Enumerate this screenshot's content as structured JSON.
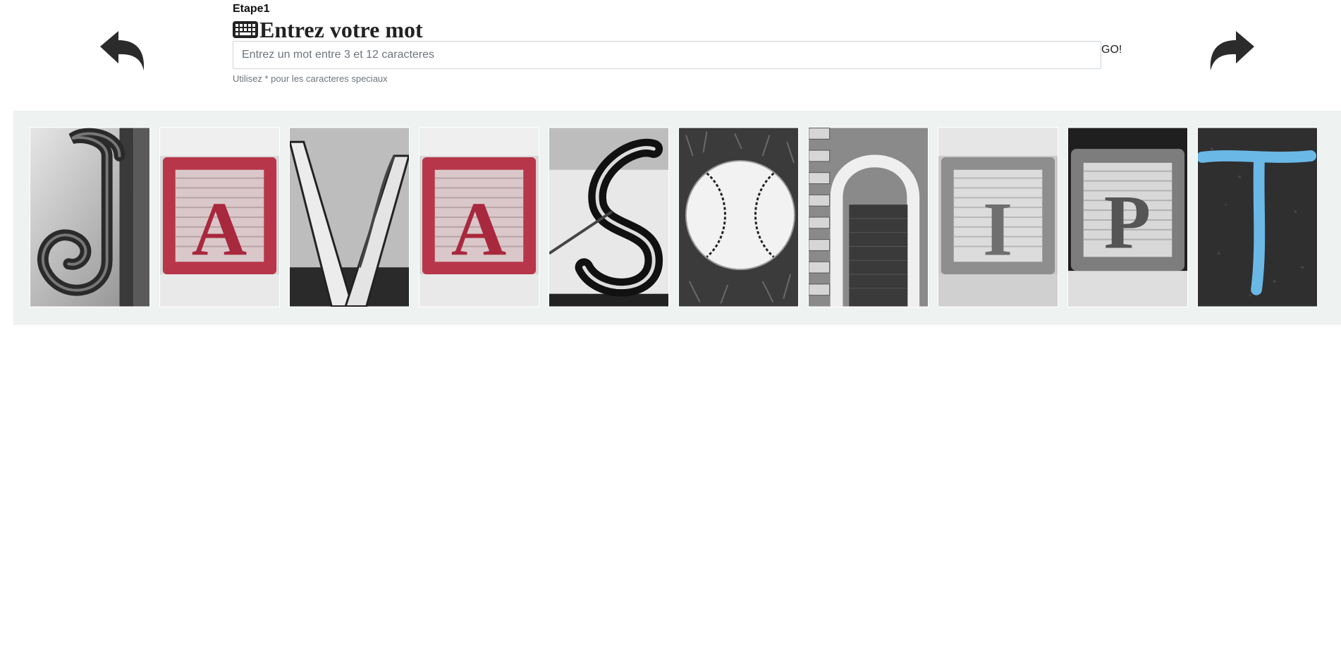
{
  "header": {
    "step_label": "Etape1",
    "title": "Entrez votre mot",
    "title_icon": "keyboard-icon"
  },
  "navigation": {
    "back_icon": "reply-arrow-icon",
    "forward_icon": "share-arrow-icon"
  },
  "form": {
    "word_value": "",
    "word_placeholder": "Entrez un mot entre 3 et 12 caracteres",
    "go_label": "GO!",
    "help_text": "Utilisez * pour les caracteres speciaux"
  },
  "letters": [
    {
      "letter": "J",
      "photo": "wrought-iron-scroll",
      "tint": "grey"
    },
    {
      "letter": "A",
      "photo": "wooden-toy-block",
      "tint": "red"
    },
    {
      "letter": "V",
      "photo": "metal-frame",
      "tint": "grey"
    },
    {
      "letter": "A",
      "photo": "wooden-toy-block",
      "tint": "red"
    },
    {
      "letter": "S",
      "photo": "curved-wire",
      "tint": "grey"
    },
    {
      "letter": "C",
      "photo": "baseball",
      "tint": "grey"
    },
    {
      "letter": "R",
      "photo": "brick-archway",
      "tint": "grey"
    },
    {
      "letter": "I",
      "photo": "wooden-toy-block",
      "tint": "grey"
    },
    {
      "letter": "P",
      "photo": "wooden-toy-block",
      "tint": "grey"
    },
    {
      "letter": "T",
      "photo": "chalk-on-asphalt",
      "tint": "blue"
    }
  ],
  "colors": {
    "strip_background": "#eef2f1",
    "arrow": "#2b2b2b",
    "block_red": "#b8364a",
    "chalk_blue": "#6ab8e6"
  }
}
